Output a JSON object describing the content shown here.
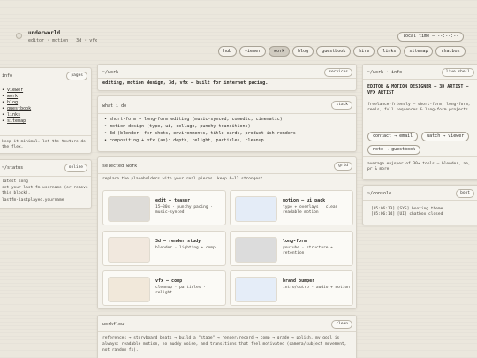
{
  "header": {
    "title": "underworld",
    "subtitle": "editor · motion · 3d · vfx",
    "clock": "local time — --:--:--"
  },
  "nav": [
    "hub",
    "viewer",
    "work",
    "blog",
    "guestbook",
    "hire",
    "links",
    "sitemap",
    "chatbox"
  ],
  "nav_active": "work",
  "info": {
    "title": "info",
    "pill": "pages",
    "links": [
      "viewer",
      "work",
      "blog",
      "guestbook",
      "links",
      "sitemap"
    ],
    "note": "keep it minimal. let the texture do the flex."
  },
  "status": {
    "title": "~/status",
    "pill": "online",
    "line1": "latest song",
    "line2": "set your last.fm username (or remove this block).",
    "line3": "lastfm·lastplayed.yourname"
  },
  "work": {
    "title": "~/work",
    "pill": "services",
    "headline": "editing, motion design, 3d, vfx — built for internet pacing."
  },
  "whatido": {
    "title": "what i do",
    "pill": "stack",
    "items": [
      "short-form + long-form editing (music-synced, comedic, cinematic)",
      "motion design (type, ui, collage, punchy transitions)",
      "3d (blender) for shots, environments, title cards, product-ish renders",
      "compositing + vfx (ae): depth, relight, particles, cleanup"
    ]
  },
  "selected": {
    "title": "selected work",
    "pill": "grid",
    "note": "replace the placeholders with your real pieces. keep 6–12 strongest.",
    "cards": [
      {
        "title": "edit — teaser",
        "desc": "15–30s · punchy pacing · music-synced",
        "thumb": "#dedcd8"
      },
      {
        "title": "motion — ui pack",
        "desc": "type + overlays · clean readable motion",
        "thumb": "#e4ecf7"
      },
      {
        "title": "3d — render study",
        "desc": "blender · lighting + comp",
        "thumb": "#f1e8de"
      },
      {
        "title": "long-form",
        "desc": "youtube · structure + retention",
        "thumb": "#dcdcdc"
      },
      {
        "title": "vfx — comp",
        "desc": "cleanup · particles · relight",
        "thumb": "#f1e8da"
      },
      {
        "title": "brand bumper",
        "desc": "intro/outro · audio + motion",
        "thumb": "#e5edf8"
      }
    ]
  },
  "workflow": {
    "title": "workflow",
    "pill": "clean",
    "text": "references → storyboard beats → build a \"stage\" → render/record → comp → grade → polish. my goal is always: readable motion, no muddy noise, and transitions that feel motivated (camera/subject movement, not random fx)."
  },
  "workinfo": {
    "title": "~/work · info",
    "pill": "live shell",
    "heading": "EDITOR & MOTION DESIGNER — 3D ARTIST — VFX ARTIST",
    "body": "freelance-friendly — short-form, long-form, reels, full sequences & long-form projects.",
    "buttons": [
      "contact → email",
      "watch → viewer",
      "note → guestbook"
    ],
    "tools": "average enjoyer of 30+ tools — blender, ae, pr & more."
  },
  "console": {
    "title": "~/console",
    "pill": "boot",
    "lines": [
      "[05:06:13] [SYS] booting theme",
      "[05:06:14] [UI] chatbox closed"
    ]
  }
}
